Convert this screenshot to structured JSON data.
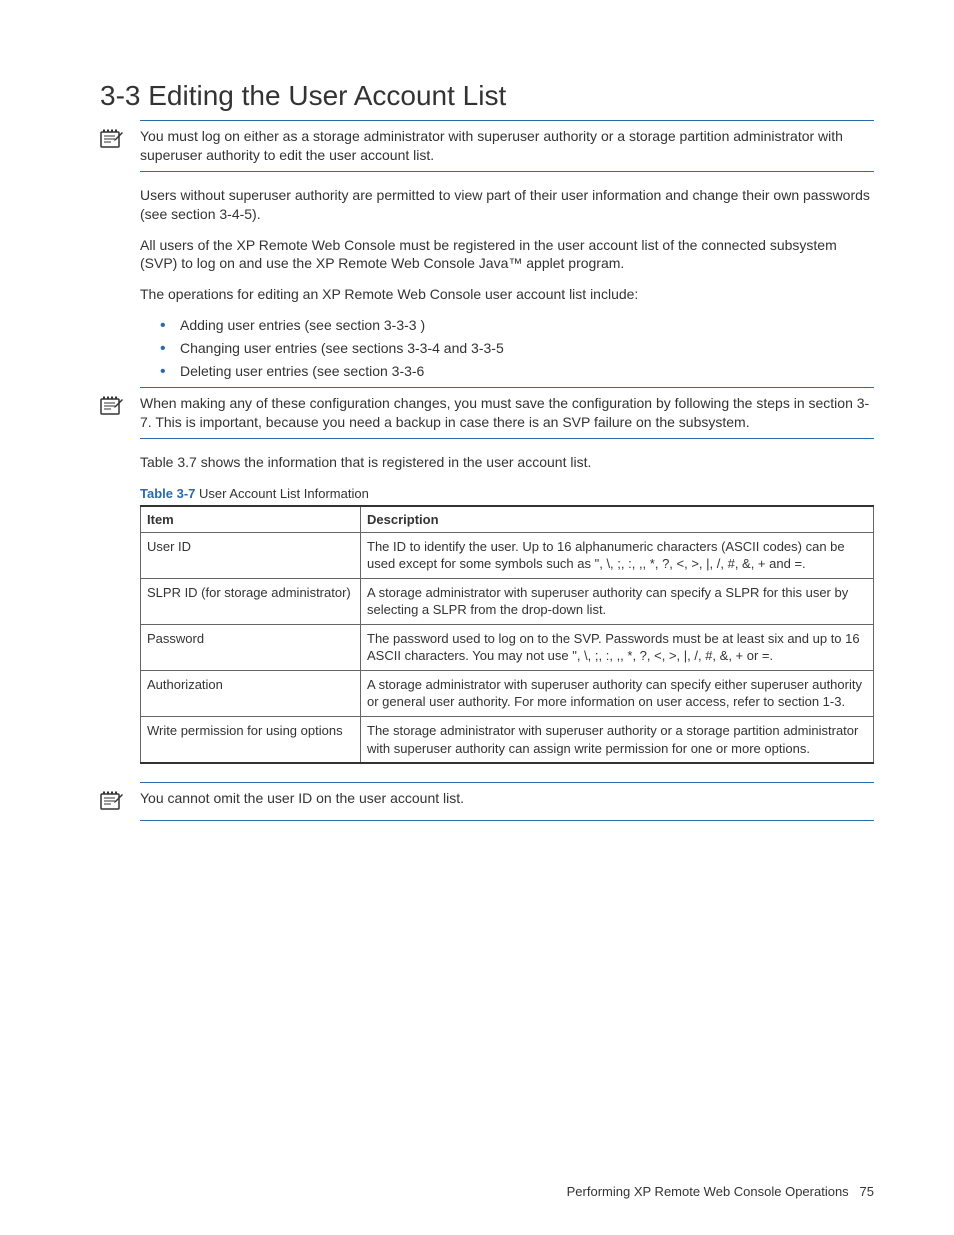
{
  "heading": "3-3 Editing the User Account List",
  "note1": "You must log on either as a storage administrator with superuser authority or a storage partition administrator with superuser authority to edit the user account list.",
  "para1": "Users without superuser authority are permitted to view part of their user information and change their own passwords (see section 3-4-5).",
  "para2": "All users of the XP Remote Web Console must be registered in the user account list of the connected subsystem (SVP) to log on and use the XP Remote Web Console Java™ applet program.",
  "para3": "The operations for editing an XP Remote Web Console user account list include:",
  "bullets": [
    "Adding user entries (see section 3-3-3 )",
    "Changing user entries (see sections 3-3-4 and 3-3-5",
    "Deleting user entries (see section 3-3-6"
  ],
  "note2": "When making any of these configuration changes, you must save the configuration by following the steps in section 3-7. This is important, because you need a backup in case there is an SVP failure on the subsystem.",
  "para4": "Table 3.7 shows the information that is registered in the user account list.",
  "tableCaptionLabel": "Table 3-7",
  "tableCaptionText": "  User Account List Information",
  "table": {
    "headers": [
      "Item",
      "Description"
    ],
    "rows": [
      {
        "item": "User ID",
        "desc": "The ID to identify the user.  Up to 16 alphanumeric characters (ASCII codes) can be used except for some symbols such as \", \\, ;, :, ,, *, ?, <, >, |, /, #, &, + and =."
      },
      {
        "item": "SLPR ID (for storage administrator)",
        "desc": "A storage administrator with superuser authority can specify a SLPR for this user by selecting a SLPR from the drop-down list."
      },
      {
        "item": "Password",
        "desc": "The password used to log on to the SVP.  Passwords must be at least six and up to 16 ASCII characters. You may not use \", \\, ;, :, ,, *, ?, <, >, |, /, #, &, + or =."
      },
      {
        "item": "Authorization",
        "desc": "A storage administrator with superuser authority can specify either superuser authority or general user authority. For more information on user access, refer to section 1-3."
      },
      {
        "item": "Write permission for using options",
        "desc": "The storage administrator with superuser authority or a storage partition administrator with superuser authority can assign write permission for one or more options."
      }
    ]
  },
  "note3": "You cannot omit the user ID on the user account list.",
  "footerText": "Performing XP Remote Web Console Operations",
  "footerPage": "75"
}
